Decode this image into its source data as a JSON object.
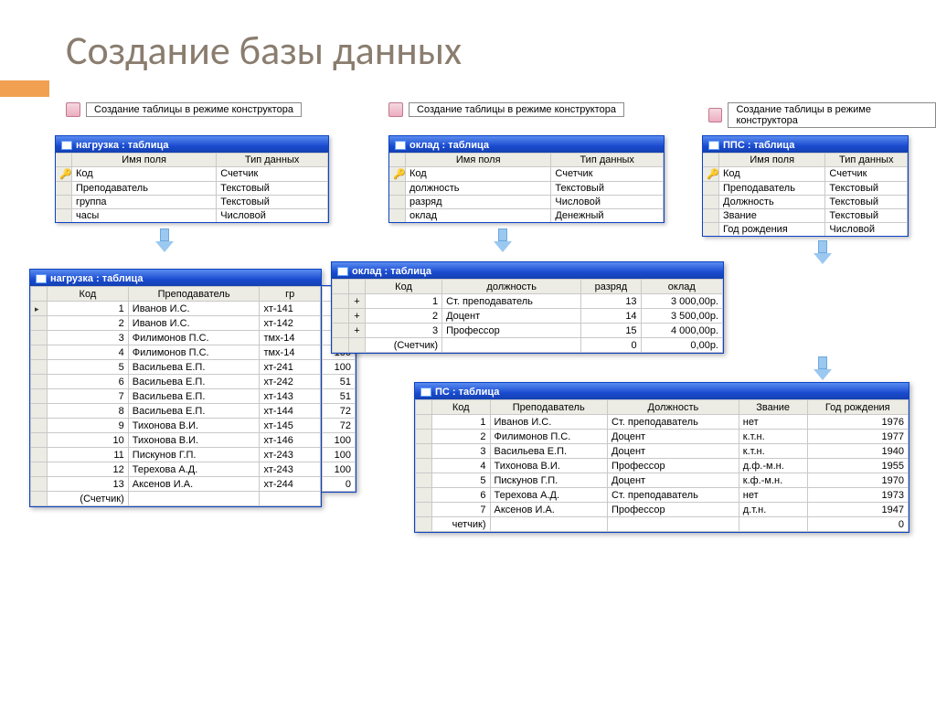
{
  "slide": {
    "title": "Создание базы данных"
  },
  "link_label": "Создание таблицы в режиме конструктора",
  "design_headers": {
    "field": "Имя поля",
    "type": "Тип данных"
  },
  "design": {
    "nagruzka": {
      "title": "нагрузка : таблица",
      "rows": [
        {
          "key": true,
          "name": "Код",
          "type": "Счетчик"
        },
        {
          "key": false,
          "name": "Преподаватель",
          "type": "Текстовый"
        },
        {
          "key": false,
          "name": "группа",
          "type": "Текстовый"
        },
        {
          "key": false,
          "name": "часы",
          "type": "Числовой"
        }
      ]
    },
    "oklad": {
      "title": "оклад : таблица",
      "rows": [
        {
          "key": true,
          "name": "Код",
          "type": "Счетчик"
        },
        {
          "key": false,
          "name": "должность",
          "type": "Текстовый"
        },
        {
          "key": false,
          "name": "разряд",
          "type": "Числовой"
        },
        {
          "key": false,
          "name": "оклад",
          "type": "Денежный"
        }
      ]
    },
    "pps": {
      "title": "ППС : таблица",
      "rows": [
        {
          "key": true,
          "name": "Код",
          "type": "Счетчик"
        },
        {
          "key": false,
          "name": "Преподаватель",
          "type": "Текстовый"
        },
        {
          "key": false,
          "name": "Должность",
          "type": "Текстовый"
        },
        {
          "key": false,
          "name": "Звание",
          "type": "Текстовый"
        },
        {
          "key": false,
          "name": "Год рождения",
          "type": "Числовой"
        }
      ]
    }
  },
  "grids": {
    "nagruzka": {
      "title": "нагрузка : таблица",
      "columns": [
        "Код",
        "Преподаватель",
        "гр"
      ],
      "rows": [
        [
          "1",
          "Иванов И.С.",
          "хт-141"
        ],
        [
          "2",
          "Иванов И.С.",
          "хт-142"
        ],
        [
          "3",
          "Филимонов П.С.",
          "тмх-14"
        ],
        [
          "4",
          "Филимонов П.С.",
          "тмх-14"
        ],
        [
          "5",
          "Васильева Е.П.",
          "хт-241"
        ],
        [
          "6",
          "Васильева Е.П.",
          "хт-242"
        ],
        [
          "7",
          "Васильева Е.П.",
          "хт-143"
        ],
        [
          "8",
          "Васильева Е.П.",
          "хт-144"
        ],
        [
          "9",
          "Тихонова В.И.",
          "хт-145"
        ],
        [
          "10",
          "Тихонова В.И.",
          "хт-146"
        ],
        [
          "11",
          "Пискунов Г.П.",
          "хт-243"
        ],
        [
          "12",
          "Терехова А.Д.",
          "хт-243"
        ],
        [
          "13",
          "Аксенов И.А.",
          "хт-244"
        ]
      ],
      "counter": "(Счетчик)",
      "hours": [
        "",
        "",
        "",
        "",
        "100",
        "100",
        "51",
        "51",
        "72",
        "72",
        "100",
        "100",
        "100",
        "0"
      ]
    },
    "oklad": {
      "title": "оклад : таблица",
      "columns": [
        "Код",
        "должность",
        "разряд",
        "оклад"
      ],
      "rows": [
        [
          "1",
          "Ст. преподаватель",
          "13",
          "3 000,00р."
        ],
        [
          "2",
          "Доцент",
          "14",
          "3 500,00р."
        ],
        [
          "3",
          "Профессор",
          "15",
          "4 000,00р."
        ]
      ],
      "counter": "(Счетчик)",
      "zero": [
        "",
        "0",
        "0,00р."
      ]
    },
    "pps": {
      "title": "ПС : таблица",
      "columns": [
        "Код",
        "Преподаватель",
        "Должность",
        "Звание",
        "Год рождения"
      ],
      "rows": [
        [
          "1",
          "Иванов И.С.",
          "Ст. преподаватель",
          "нет",
          "1976"
        ],
        [
          "2",
          "Филимонов П.С.",
          "Доцент",
          "к.т.н.",
          "1977"
        ],
        [
          "3",
          "Васильева Е.П.",
          "Доцент",
          "к.т.н.",
          "1940"
        ],
        [
          "4",
          "Тихонова В.И.",
          "Профессор",
          "д.ф.-м.н.",
          "1955"
        ],
        [
          "5",
          "Пискунов Г.П.",
          "Доцент",
          "к.ф.-м.н.",
          "1970"
        ],
        [
          "6",
          "Терехова А.Д.",
          "Ст. преподаватель",
          "нет",
          "1973"
        ],
        [
          "7",
          "Аксенов И.А.",
          "Профессор",
          "д.т.н.",
          "1947"
        ]
      ],
      "counter": "четчик)",
      "zero": "0"
    }
  }
}
